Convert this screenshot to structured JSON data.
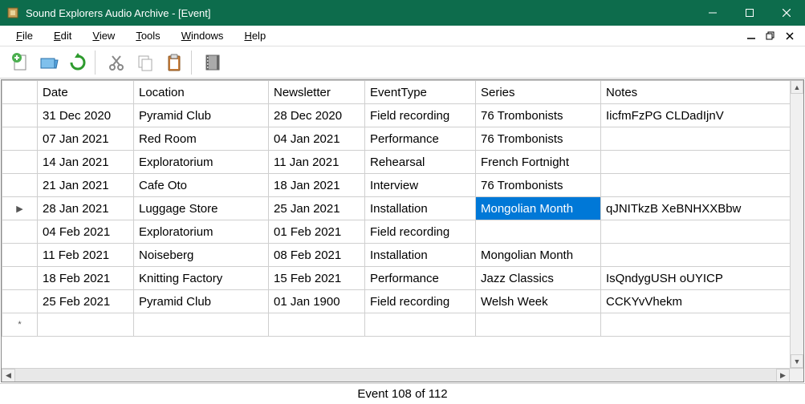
{
  "window": {
    "title": "Sound Explorers Audio Archive - [Event]"
  },
  "menu": {
    "file": "File",
    "edit": "Edit",
    "view": "View",
    "tools": "Tools",
    "windows": "Windows",
    "help": "Help"
  },
  "table": {
    "columns": {
      "date": "Date",
      "location": "Location",
      "newsletter": "Newsletter",
      "eventType": "EventType",
      "series": "Series",
      "notes": "Notes"
    },
    "rows": [
      {
        "date": "31 Dec 2020",
        "location": "Pyramid Club",
        "newsletter": "28 Dec 2020",
        "eventType": "Field recording",
        "series": "76 Trombonists",
        "notes": "IicfmFzPG CLDadIjnV"
      },
      {
        "date": "07 Jan 2021",
        "location": "Red Room",
        "newsletter": "04 Jan 2021",
        "eventType": "Performance",
        "series": "76 Trombonists",
        "notes": ""
      },
      {
        "date": "14 Jan 2021",
        "location": "Exploratorium",
        "newsletter": "11 Jan 2021",
        "eventType": "Rehearsal",
        "series": "French Fortnight",
        "notes": ""
      },
      {
        "date": "21 Jan 2021",
        "location": "Cafe Oto",
        "newsletter": "18 Jan 2021",
        "eventType": "Interview",
        "series": "76 Trombonists",
        "notes": ""
      },
      {
        "date": "28 Jan 2021",
        "location": "Luggage Store",
        "newsletter": "25 Jan 2021",
        "eventType": "Installation",
        "series": "Mongolian Month",
        "notes": "qJNITkzB XeBNHXXBbw",
        "selected": "series",
        "gutter": "▶"
      },
      {
        "date": "04 Feb 2021",
        "location": "Exploratorium",
        "newsletter": "01 Feb 2021",
        "eventType": "Field recording",
        "series": "",
        "notes": ""
      },
      {
        "date": "11 Feb 2021",
        "location": "Noiseberg",
        "newsletter": "08 Feb 2021",
        "eventType": "Installation",
        "series": "Mongolian Month",
        "notes": ""
      },
      {
        "date": "18 Feb 2021",
        "location": "Knitting Factory",
        "newsletter": "15 Feb 2021",
        "eventType": "Performance",
        "series": "Jazz Classics",
        "notes": "IsQndygUSH oUYICP"
      },
      {
        "date": "25 Feb 2021",
        "location": "Pyramid Club",
        "newsletter": "01 Jan 1900",
        "eventType": "Field recording",
        "series": "Welsh Week",
        "notes": "CCKYvVhekm"
      },
      {
        "date": "",
        "location": "",
        "newsletter": "",
        "eventType": "",
        "series": "",
        "notes": "",
        "gutter": "*"
      }
    ]
  },
  "status": "Event 108 of 112"
}
